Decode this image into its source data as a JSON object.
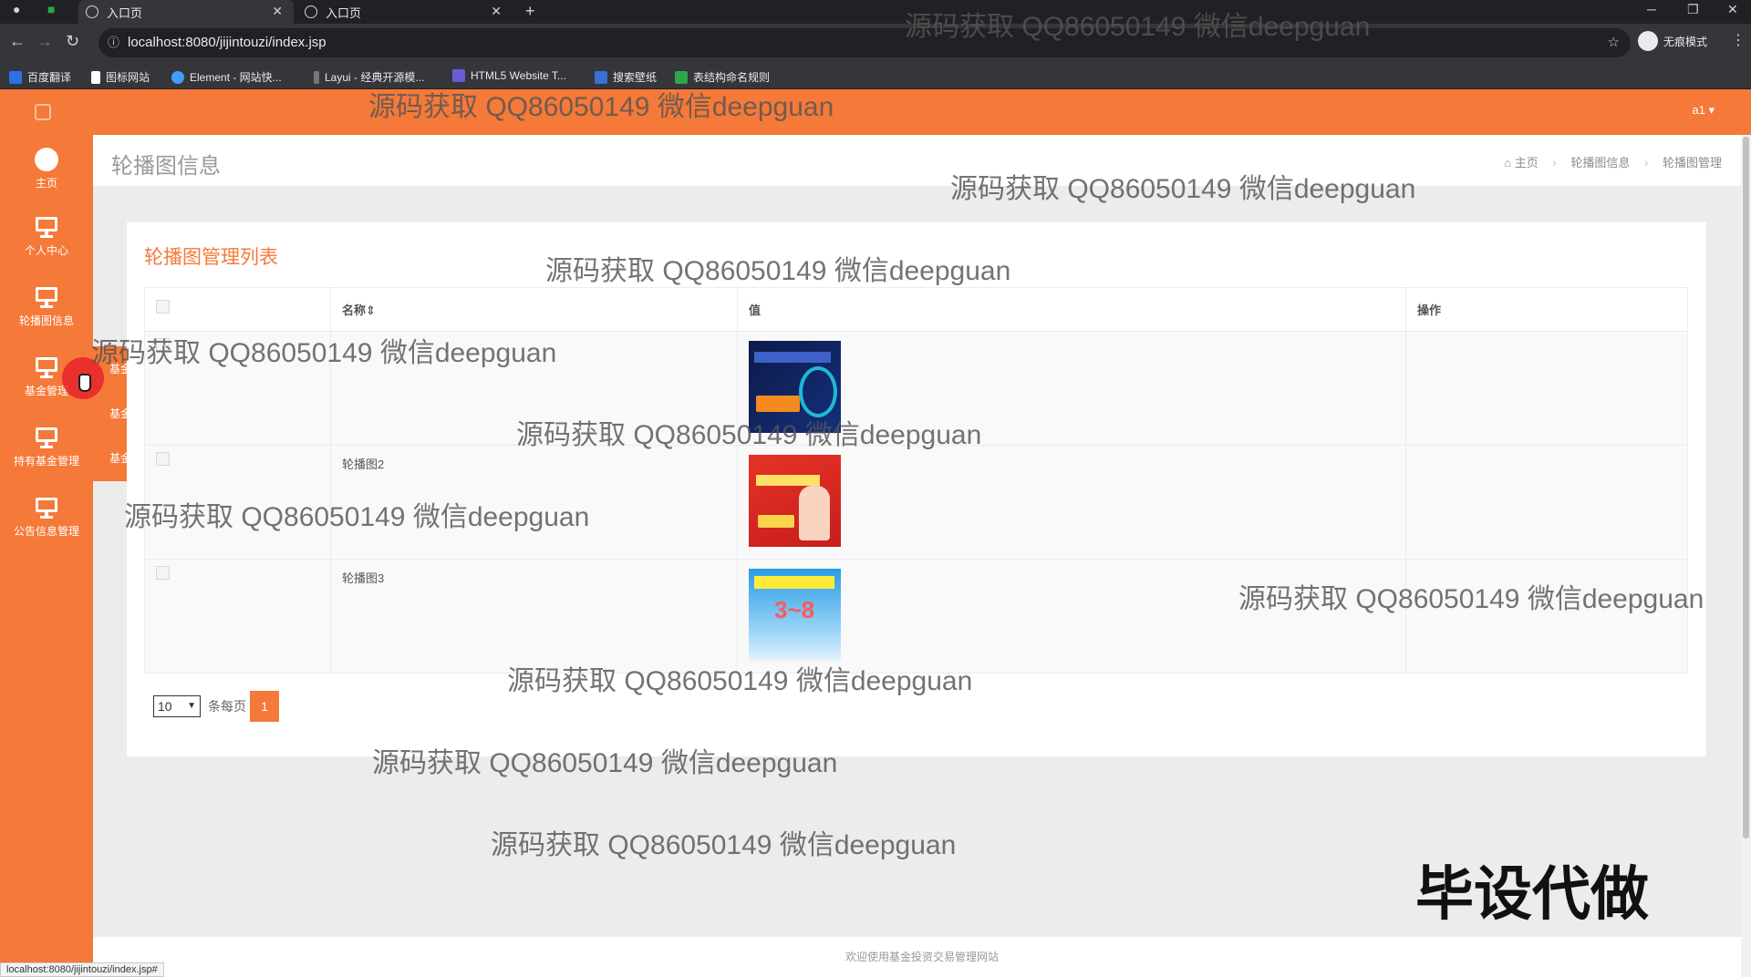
{
  "browser": {
    "tabs": [
      {
        "title": "入口页"
      },
      {
        "title": "入口页"
      }
    ],
    "url": "localhost:8080/jijintouzi/index.jsp",
    "profile_label": "无痕模式",
    "bookmarks": [
      "百度翻译",
      "图标网站",
      "Element - 网站快...",
      "Layui - 经典开源模...",
      "HTML5 Website T...",
      "搜索壁纸",
      "表结构命名规则"
    ],
    "status_url": "localhost:8080/jijintouzi/index.jsp#"
  },
  "header": {
    "user": "a1 ▾"
  },
  "sidebar": {
    "items": [
      {
        "label": "主页",
        "icon": "dashboard-icon"
      },
      {
        "label": "个人中心",
        "icon": "monitor-icon"
      },
      {
        "label": "轮播图信息",
        "icon": "monitor-icon"
      },
      {
        "label": "基金管理",
        "icon": "monitor-icon"
      },
      {
        "label": "持有基金管理",
        "icon": "monitor-icon"
      },
      {
        "label": "公告信息管理",
        "icon": "monitor-icon"
      }
    ],
    "flyout": [
      "基金管理",
      "基金净值管理",
      "基金自选管理"
    ]
  },
  "page": {
    "title": "轮播图信息",
    "breadcrumb": [
      "主页",
      "轮播图信息",
      "轮播图管理"
    ]
  },
  "table": {
    "title": "轮播图管理列表",
    "columns": [
      "",
      "名称⇕",
      "值",
      "操作"
    ],
    "rows": [
      {
        "name": ""
      },
      {
        "name": "轮播图2"
      },
      {
        "name": "轮播图3"
      }
    ]
  },
  "pager": {
    "page_size": "10",
    "per_page_label": "条每页",
    "current_page": "1"
  },
  "footer": {
    "text": "欢迎使用基金投资交易管理网站"
  },
  "watermark": {
    "text": "源码获取 QQ86050149 微信deepguan",
    "stamp": "毕设代做"
  }
}
